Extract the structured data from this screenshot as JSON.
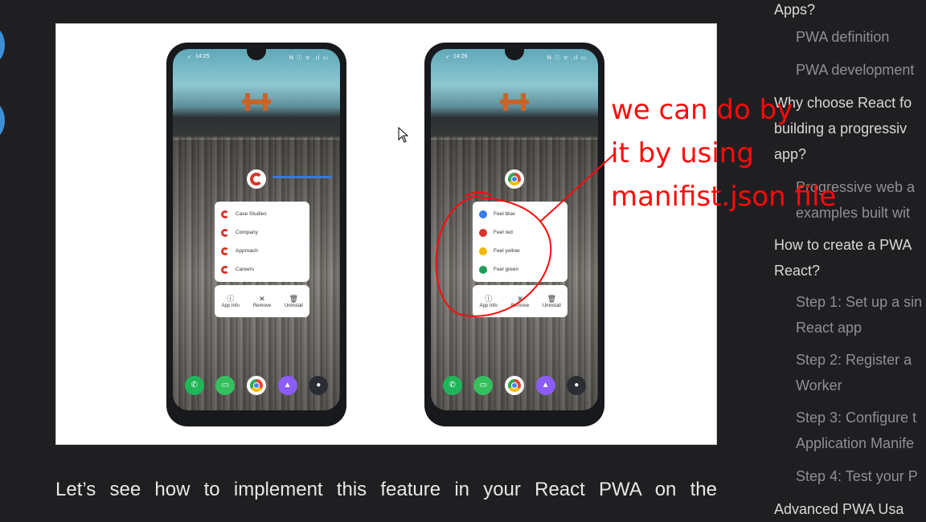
{
  "figure": {
    "phones": [
      {
        "time": "14:25",
        "status_icons": "✓",
        "status_right": "N ⓘ ᯤ .ıl ▭",
        "app_icon": "c-logo-icon",
        "menu_items": [
          {
            "label": "Case Studies",
            "icon": "c-logo-icon",
            "color": "#d9342b"
          },
          {
            "label": "Company",
            "icon": "c-logo-icon",
            "color": "#d9342b"
          },
          {
            "label": "Approach",
            "icon": "c-logo-icon",
            "color": "#d9342b"
          },
          {
            "label": "Careers",
            "icon": "c-logo-icon",
            "color": "#d9342b"
          }
        ],
        "actions": [
          {
            "symbol": "ⓘ",
            "label": "App Info"
          },
          {
            "symbol": "✕",
            "label": "Remove"
          },
          {
            "symbol": "🗑",
            "label": "Uninstall"
          }
        ]
      },
      {
        "time": "14:26",
        "status_icons": "✓",
        "status_right": "N ⓘ ᯤ .ıl ▭",
        "app_icon": "chrome-icon",
        "menu_items": [
          {
            "label": "Feel blue",
            "icon": "dot-icon",
            "color": "#3b7be8"
          },
          {
            "label": "Feel red",
            "icon": "dot-icon",
            "color": "#d9342b"
          },
          {
            "label": "Feel yellow",
            "icon": "dot-icon",
            "color": "#f2b705"
          },
          {
            "label": "Feel green",
            "icon": "dot-icon",
            "color": "#1e9e55"
          }
        ],
        "actions": [
          {
            "symbol": "ⓘ",
            "label": "App Info"
          },
          {
            "symbol": "✕",
            "label": "Remove"
          },
          {
            "symbol": "🗑",
            "label": "Uninstall"
          }
        ]
      }
    ],
    "dock": [
      {
        "icon": "phone-icon",
        "glyph": "✆",
        "color": "#1fb65a"
      },
      {
        "icon": "messages-icon",
        "glyph": "▭",
        "color": "#35c05e"
      },
      {
        "icon": "chrome-icon",
        "glyph": "",
        "color": "#ffffff"
      },
      {
        "icon": "gallery-icon",
        "glyph": "▲",
        "color": "#8b5cf6"
      },
      {
        "icon": "camera-icon",
        "glyph": "●",
        "color": "#2a2d33"
      }
    ]
  },
  "annotation": {
    "lines": [
      "we can do by",
      "it by using",
      "manifist.json file"
    ],
    "color": "#ff0a0a"
  },
  "paragraph": "Let’s see how to implement this feature in your React PWA on the",
  "toc": [
    {
      "text": "Apps?",
      "level": 1
    },
    {
      "text": "PWA definition",
      "level": 2
    },
    {
      "text": "PWA development",
      "level": 2
    },
    {
      "text": "Why choose React fo\nbuilding a progressiv\napp?",
      "level": 1
    },
    {
      "text": "Progressive web a\nexamples built wit",
      "level": 2
    },
    {
      "text": "How to create a PWA\nReact?",
      "level": 1
    },
    {
      "text": "Step 1: Set up a sin\nReact app",
      "level": 2
    },
    {
      "text": "Step 2: Register a\nWorker",
      "level": 2
    },
    {
      "text": "Step 3: Configure t\nApplication Manife",
      "level": 2
    },
    {
      "text": "Step 4: Test your P",
      "level": 2
    },
    {
      "text": "Advanced PWA Usa",
      "level": 1
    }
  ]
}
